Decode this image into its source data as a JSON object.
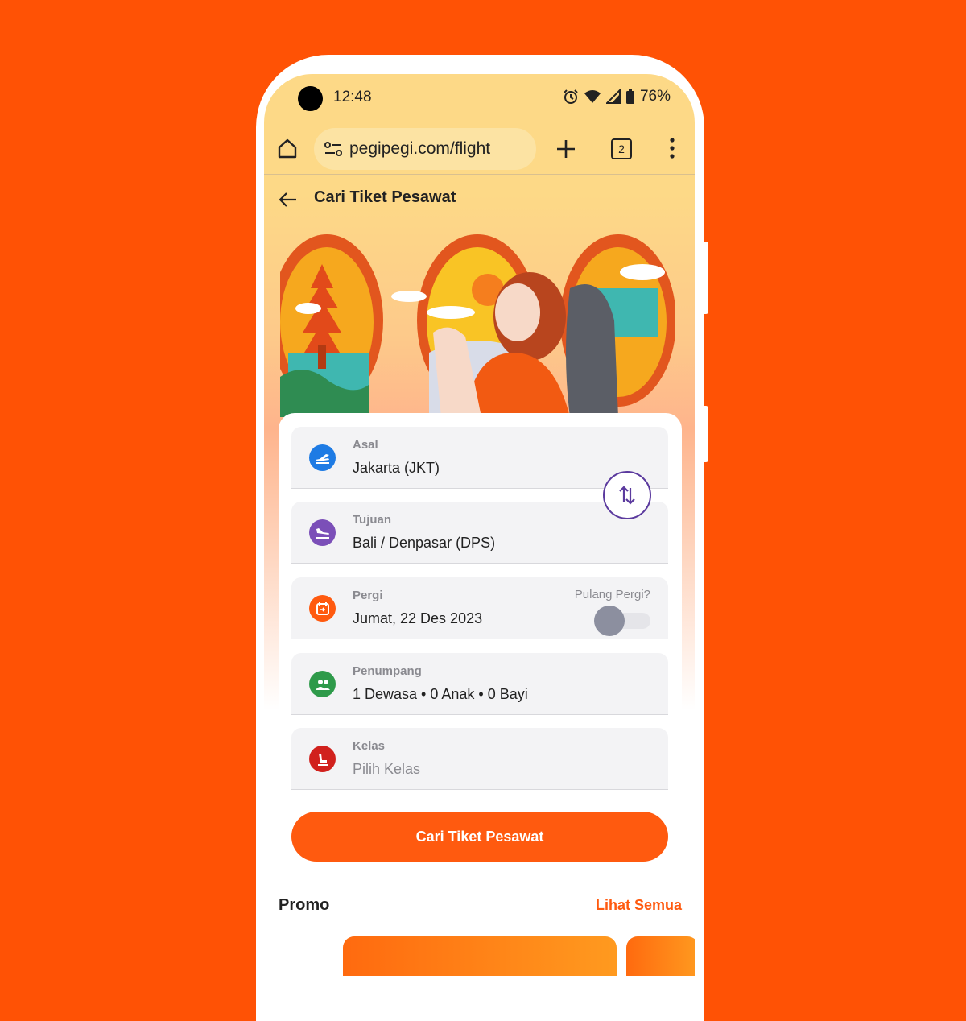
{
  "colors": {
    "background": "#FF5205",
    "accent": "#FF5A0F",
    "asal_icon": "#1E7BE4",
    "tujuan_icon": "#7B4FB8",
    "pergi_icon": "#FF5A0F",
    "penumpang_icon": "#2E9A4A",
    "kelas_icon": "#D1211D",
    "swap_border": "#5B3A9E"
  },
  "status_bar": {
    "time": "12:48",
    "battery": "76%",
    "icons": [
      "alarm-icon",
      "wifi-icon",
      "signal-icon",
      "battery-icon"
    ]
  },
  "browser": {
    "url": "pegipegi.com/flight",
    "tab_count": "2",
    "icons": [
      "home-icon",
      "site-settings-icon",
      "plus-icon",
      "tabs-icon",
      "more-vert-icon"
    ]
  },
  "page": {
    "title": "Cari Tiket Pesawat"
  },
  "form": {
    "asal": {
      "label": "Asal",
      "value": "Jakarta (JKT)",
      "icon": "takeoff-icon"
    },
    "tujuan": {
      "label": "Tujuan",
      "value": "Bali / Denpasar (DPS)",
      "icon": "landing-icon"
    },
    "pergi": {
      "label": "Pergi",
      "value": "Jumat, 22 Des 2023",
      "icon": "calendar-icon",
      "roundtrip_label": "Pulang Pergi?",
      "roundtrip_on": false
    },
    "penumpang": {
      "label": "Penumpang",
      "value": "1 Dewasa • 0 Anak • 0 Bayi",
      "icon": "people-icon"
    },
    "kelas": {
      "label": "Kelas",
      "placeholder": "Pilih Kelas",
      "icon": "seat-icon"
    },
    "swap_icon": "swap-vertical-icon",
    "submit_label": "Cari Tiket Pesawat"
  },
  "promo": {
    "title": "Promo",
    "see_all": "Lihat Semua"
  }
}
